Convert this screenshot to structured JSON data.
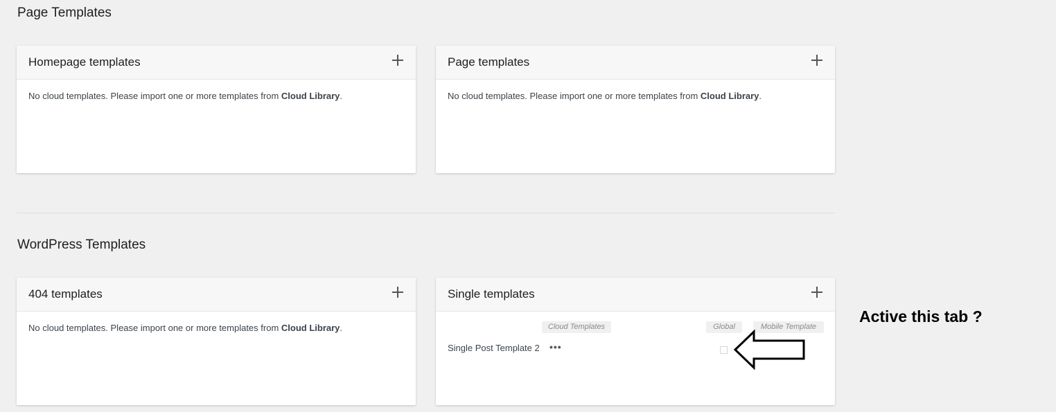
{
  "sections": {
    "page_templates": "Page Templates",
    "wordpress_templates": "WordPress Templates"
  },
  "empty_message": {
    "prefix": "No cloud templates. Please import one or more templates from ",
    "link": "Cloud Library",
    "suffix": "."
  },
  "cards": {
    "homepage": "Homepage templates",
    "page": "Page templates",
    "notfound": "404 templates",
    "single": "Single templates"
  },
  "single": {
    "columns": {
      "cloud": "Cloud Templates",
      "global": "Global",
      "mobile": "Mobile Template"
    },
    "row": {
      "name": "Single Post Template 2",
      "actions": "•••",
      "global_checked": false,
      "mobile": "-"
    }
  },
  "annotation": {
    "text": "Active this tab ?",
    "arrow": "left-arrow-icon"
  }
}
